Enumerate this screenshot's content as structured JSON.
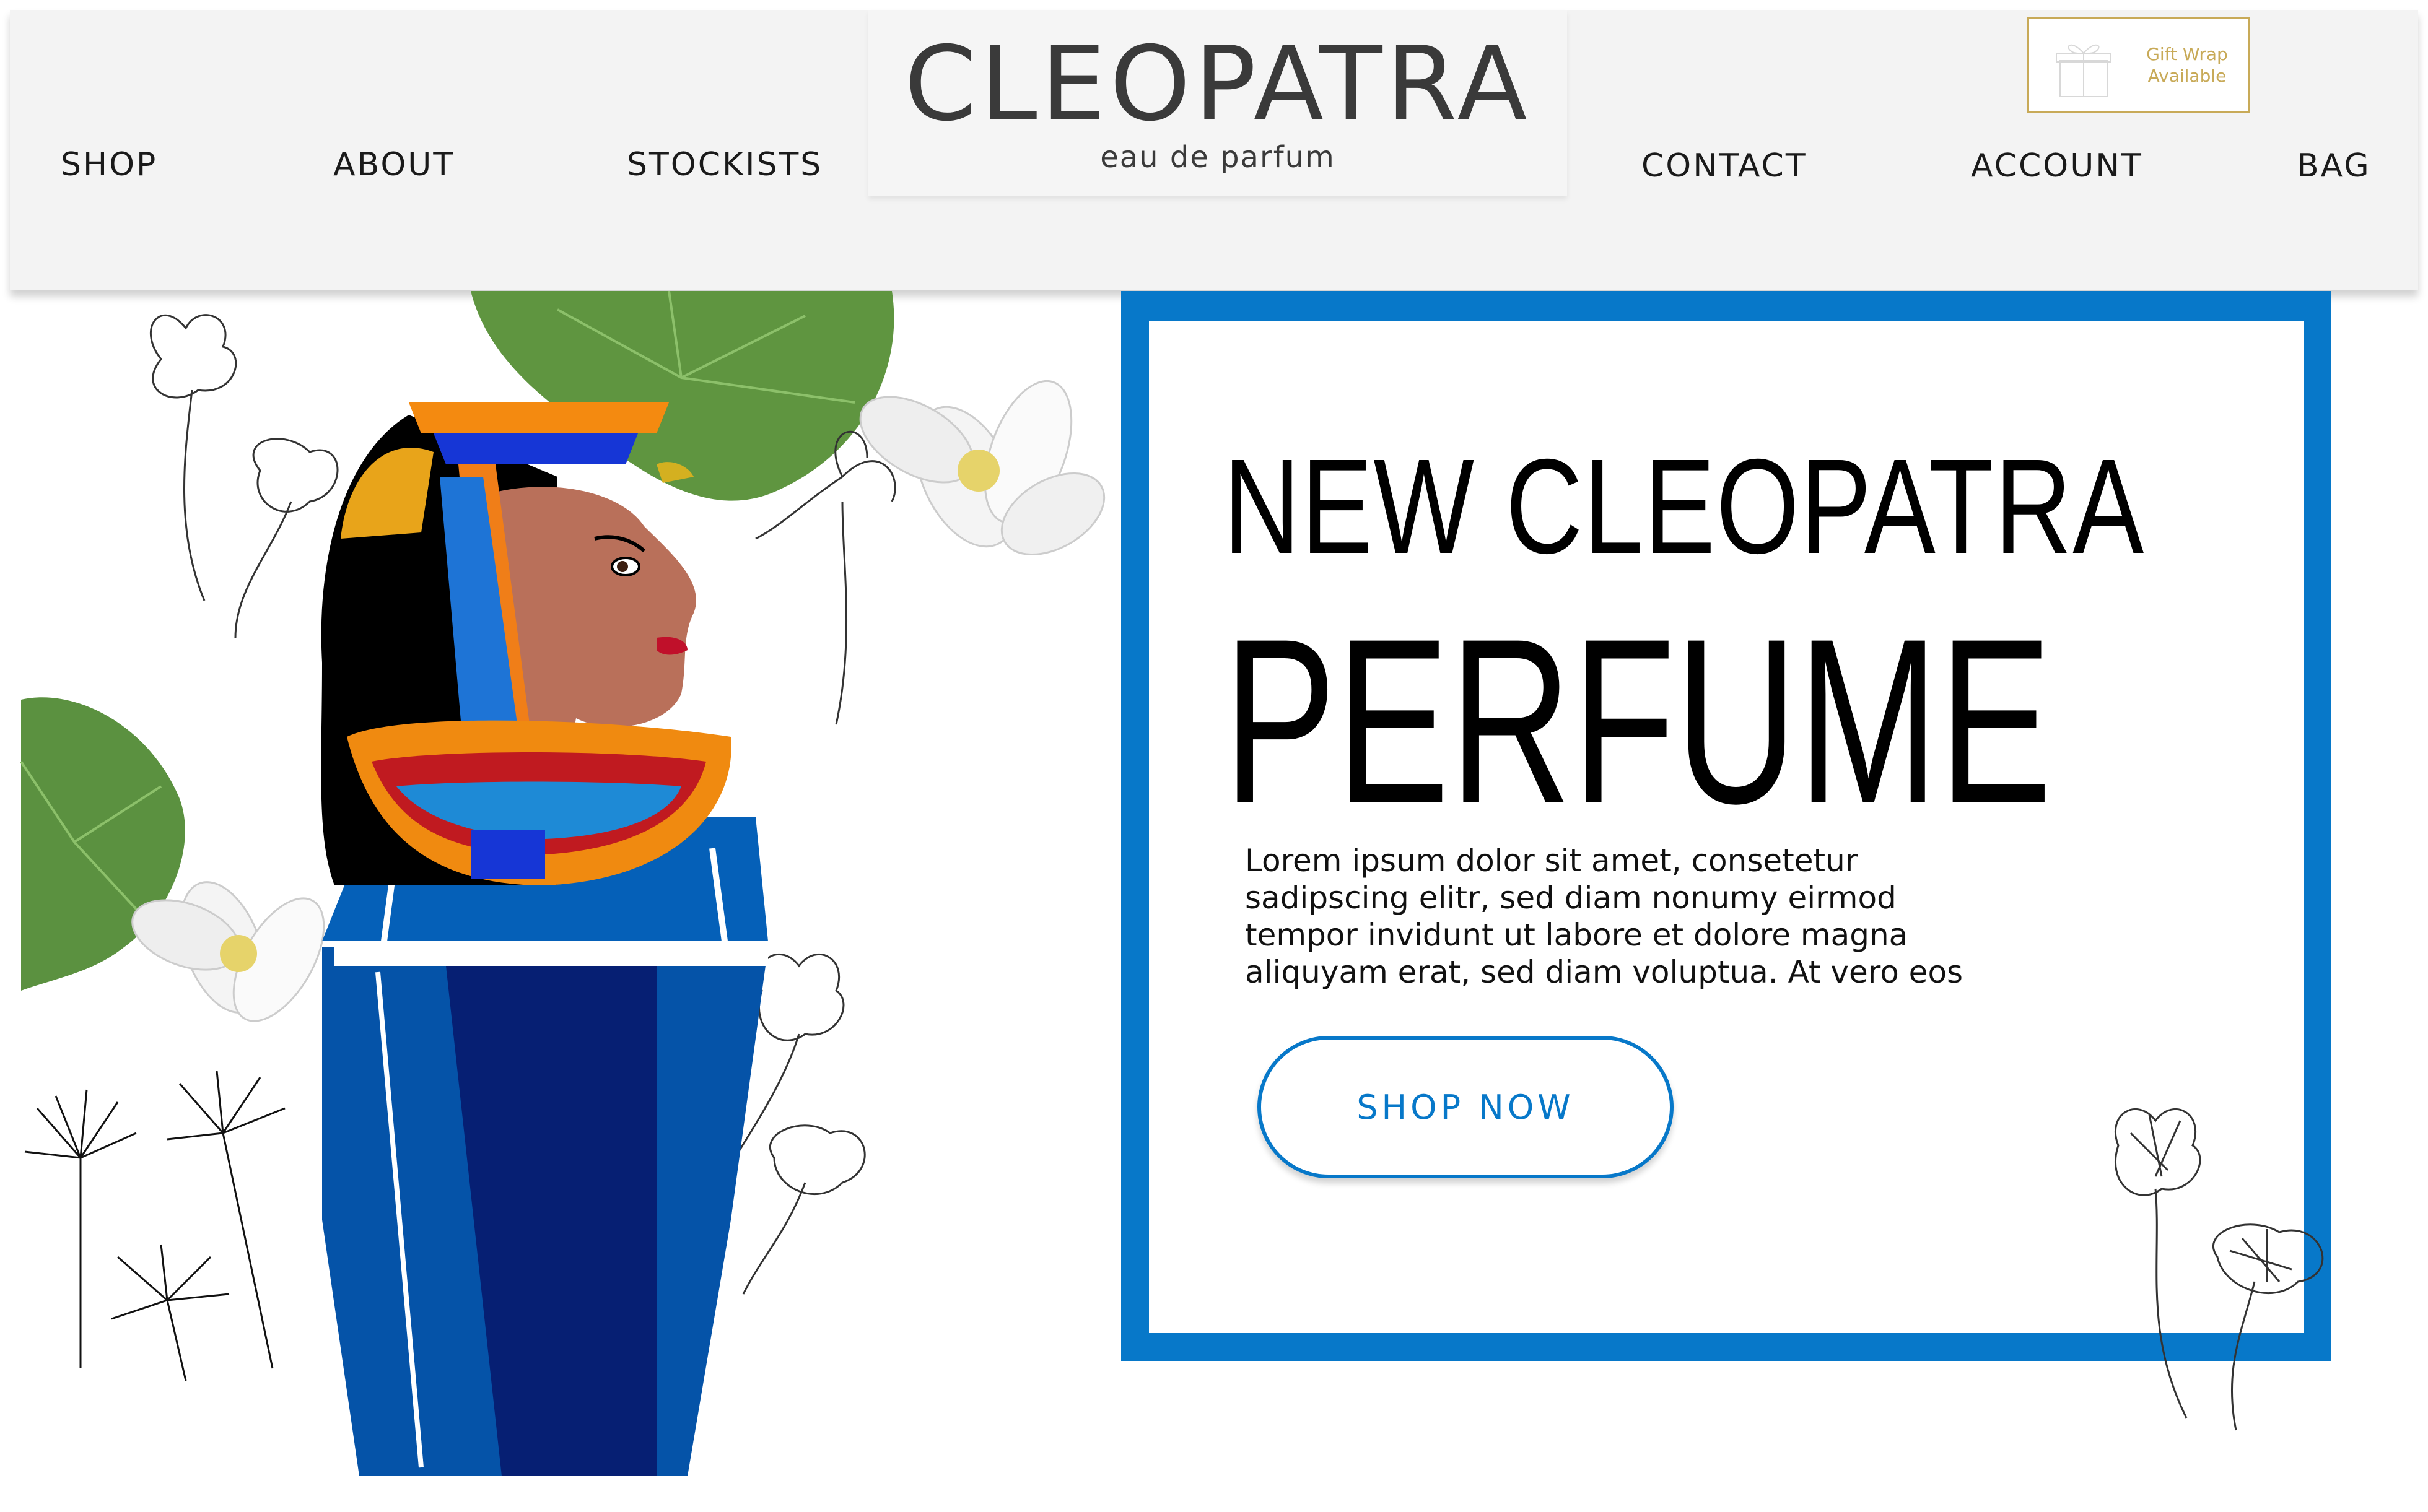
{
  "header": {
    "nav_left": [
      "SHOP",
      "ABOUT",
      "STOCKISTS"
    ],
    "nav_right": [
      "CONTACT",
      "ACCOUNT",
      "BAG"
    ],
    "brand": "CLEOPATRA",
    "tagline": "eau de parfum",
    "gift_wrap": {
      "line1": "Gift Wrap",
      "line2": "Available",
      "icon": "gift-box-icon"
    }
  },
  "hero": {
    "headline_line1": "NEW CLEOPATRA",
    "headline_line2": "PERFUME",
    "body": "Lorem ipsum dolor sit amet, consetetur sadipscing elitr, sed diam nonumy eirmod tempor invidunt ut labore et dolore magna aliquyam erat, sed diam voluptua. At vero eos",
    "cta": "SHOP NOW"
  },
  "colors": {
    "accent_blue": "#0778c9",
    "gold": "#c8aa58",
    "header_bg": "#f3f3f3"
  }
}
